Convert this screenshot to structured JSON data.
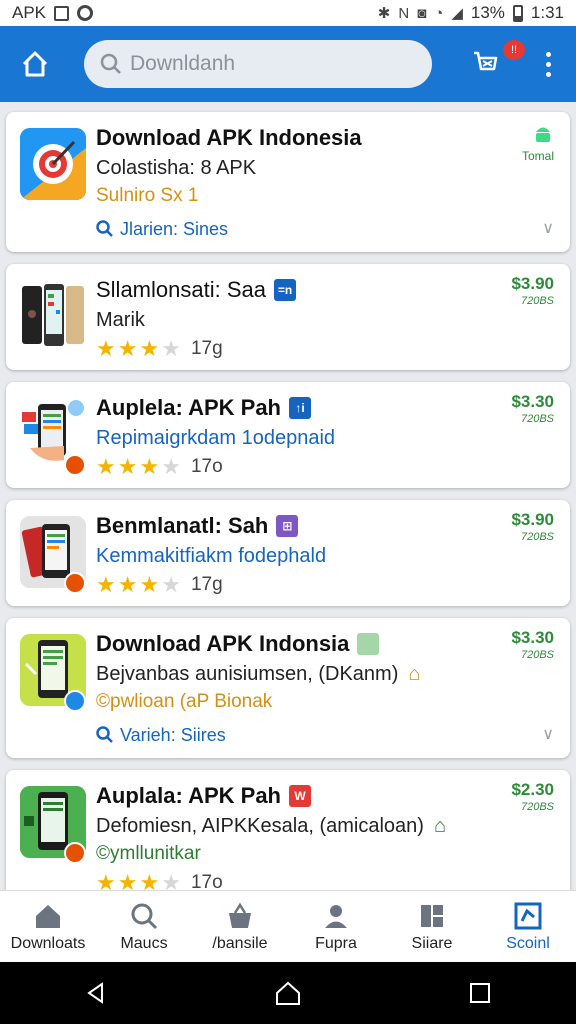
{
  "status_bar": {
    "left_text": "APK",
    "battery": "13%",
    "time": "1:31"
  },
  "search": {
    "placeholder": "Downldanh"
  },
  "cart": {
    "badge": "!!"
  },
  "cards": [
    {
      "title": "Download APK Indonesia",
      "sub": "Colastisha: 8 APK",
      "dev": "Sulniro Sx 1",
      "meta": "Jlarien: Sines",
      "price_label": "Tomal"
    },
    {
      "title": "Sllamlonsati: Saa",
      "tag": "=n",
      "sub": "Marik",
      "rating_count": "17g",
      "price": "$3.90",
      "price_sub": "720BS"
    },
    {
      "title": "Auplela: APK Pah",
      "tag": "↑i",
      "sub": "Repimaigrkdam 1odepnaid",
      "rating_count": "17o",
      "price": "$3.30",
      "price_sub": "720BS"
    },
    {
      "title": "Benmlanatl: Sah",
      "tag": "⊞",
      "sub": "Kemmakitfiakm fodephald",
      "rating_count": "17g",
      "price": "$3.90",
      "price_sub": "720BS"
    },
    {
      "title": "Download APK Indonsia",
      "sub": "Bejvanbas aunisiumsen, (DKanm)",
      "dev": "©pwlioan (aP Bionak",
      "meta": "Varieh: Siires",
      "price": "$3.30",
      "price_sub": "720BS"
    },
    {
      "title": "Auplala: APK Pah",
      "tag": "W",
      "sub": "Defomiesn, AIPKKesala, (amicaloan)",
      "dev": "©ymllunitkar",
      "rating_count": "17o",
      "price": "$2.30",
      "price_sub": "720BS"
    }
  ],
  "bottom_nav": [
    {
      "label": "Downloats"
    },
    {
      "label": "Maucs"
    },
    {
      "label": "/bansile"
    },
    {
      "label": "Fupra"
    },
    {
      "label": "Siiare"
    },
    {
      "label": "Scoinl"
    }
  ],
  "colors": {
    "app_bar": "#1976d2",
    "price_green": "#2e8b3a",
    "link_blue": "#1565c0",
    "star": "#f4b400"
  }
}
